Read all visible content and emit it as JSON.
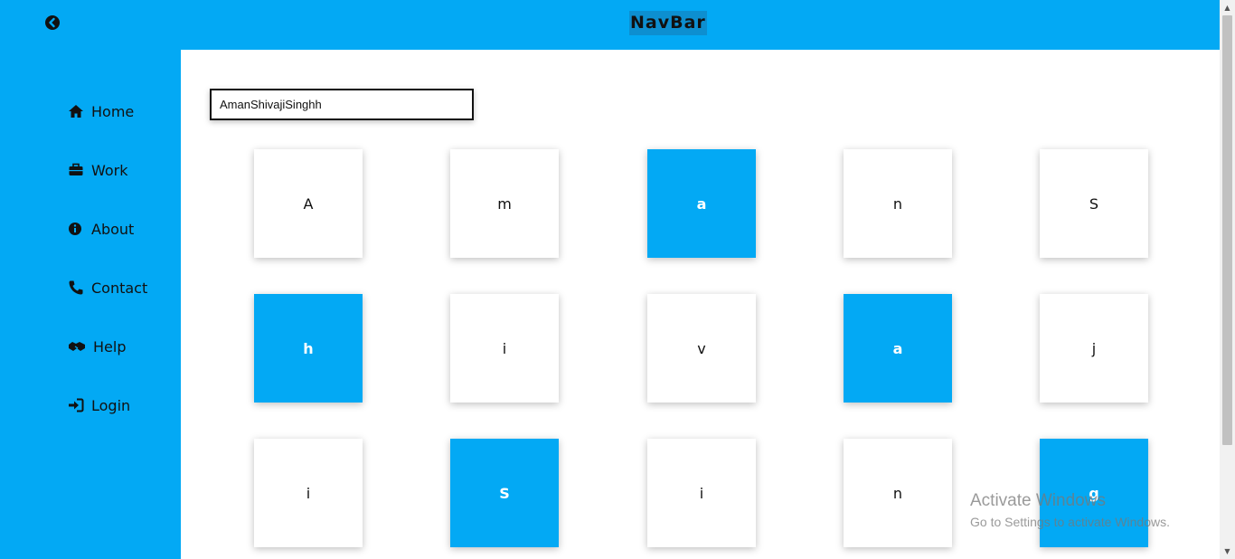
{
  "header": {
    "brand": "NavBar",
    "back_icon": "circle-arrow-left-icon"
  },
  "sidebar": {
    "items": [
      {
        "label": "Home",
        "icon": "home-icon"
      },
      {
        "label": "Work",
        "icon": "briefcase-icon"
      },
      {
        "label": "About",
        "icon": "info-circle-icon"
      },
      {
        "label": "Contact",
        "icon": "phone-icon"
      },
      {
        "label": "Help",
        "icon": "handshake-icon"
      },
      {
        "label": "Login",
        "icon": "sign-in-icon"
      }
    ]
  },
  "main": {
    "name_input_value": "AmanShivajiSinghh",
    "tiles": [
      {
        "letter": "A",
        "active": false
      },
      {
        "letter": "m",
        "active": false
      },
      {
        "letter": "a",
        "active": true
      },
      {
        "letter": "n",
        "active": false
      },
      {
        "letter": "S",
        "active": false
      },
      {
        "letter": "h",
        "active": true
      },
      {
        "letter": "i",
        "active": false
      },
      {
        "letter": "v",
        "active": false
      },
      {
        "letter": "a",
        "active": true
      },
      {
        "letter": "j",
        "active": false
      },
      {
        "letter": "i",
        "active": false
      },
      {
        "letter": "S",
        "active": true
      },
      {
        "letter": "i",
        "active": false
      },
      {
        "letter": "n",
        "active": false
      },
      {
        "letter": "g",
        "active": true
      }
    ]
  },
  "watermark": {
    "title": "Activate Windows",
    "subtitle": "Go to Settings to activate Windows."
  },
  "colors": {
    "accent": "#03a9f4",
    "tile_bg": "#ffffff",
    "text": "#111111"
  }
}
